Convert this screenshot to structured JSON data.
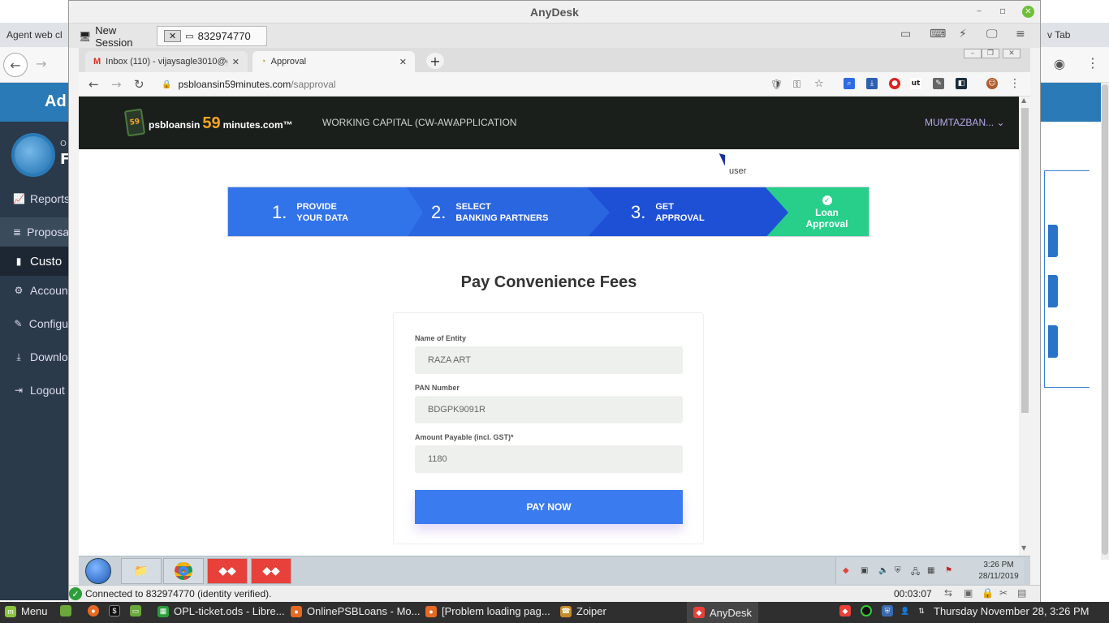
{
  "host": {
    "tab_left_label": "Agent web cl",
    "tab_right_label": "v Tab",
    "sidebar": {
      "header": "Ad",
      "logo_letters": "F",
      "logo_small": "O",
      "items": [
        {
          "label": "Reports",
          "icon": "chart-line-icon"
        },
        {
          "label": "Proposa",
          "icon": "database-icon"
        },
        {
          "label": "Custo",
          "icon": "bar-chart-icon"
        },
        {
          "label": "Accoun",
          "icon": "gear-icon"
        },
        {
          "label": "Configu",
          "icon": "edit-icon"
        },
        {
          "label": "Downlo",
          "icon": "download-icon"
        },
        {
          "label": "Logout",
          "icon": "logout-icon"
        }
      ]
    }
  },
  "anydesk": {
    "title": "AnyDesk",
    "tabs": {
      "new_session": "New Session",
      "remote_id": "832974770"
    },
    "status": {
      "text": "Connected to 832974770 (identity verified).",
      "timer": "00:03:07"
    }
  },
  "remote": {
    "browser": {
      "tabs": [
        {
          "title": "Inbox (110) - vijaysagle3010@gm",
          "icon": "gmail-icon"
        },
        {
          "title": "Approval",
          "icon": "site-icon"
        }
      ],
      "url_host": "psbloansin59minutes.com",
      "url_path": "/sapproval"
    },
    "site": {
      "logo_prefix": "psbloansin",
      "logo_number": "59",
      "logo_suffix": "minutes.com™",
      "logo_badge": "59",
      "nav_working_capital": "WORKING CAPITAL (CW-AW...",
      "nav_application": "APPLICATION",
      "user_menu": "MUMTAZBAN...",
      "tooltip": "user",
      "steps": [
        {
          "number": "1.",
          "line1": "PROVIDE",
          "line2": "YOUR DATA"
        },
        {
          "number": "2.",
          "line1": "SELECT",
          "line2": "BANKING PARTNERS"
        },
        {
          "number": "3.",
          "line1": "GET",
          "line2": "APPROVAL"
        },
        {
          "line1": "Loan",
          "line2": "Approval"
        }
      ],
      "page_title": "Pay Convenience Fees",
      "form": {
        "entity_label": "Name of Entity",
        "entity_value": "RAZA ART",
        "pan_label": "PAN Number",
        "pan_value": "BDGPK9091R",
        "amount_label": "Amount Payable (incl. GST)*",
        "amount_value": "1180",
        "pay_button": "PAY NOW"
      }
    },
    "taskbar": {
      "time": "3:26 PM",
      "date": "28/11/2019"
    }
  },
  "mint_panel": {
    "menu": "Menu",
    "windows": [
      "OPL-ticket.ods - Libre...",
      "OnlinePSBLoans - Mo...",
      "[Problem loading pag...",
      "Zoiper",
      "AnyDesk"
    ],
    "clock": "Thursday November 28,  3:26 PM"
  },
  "colors": {
    "stepper_blue": "#2d6be5",
    "stepper_green": "#27cf8a",
    "pay_button": "#3b7bf0",
    "site_header": "#1a1f1c"
  }
}
